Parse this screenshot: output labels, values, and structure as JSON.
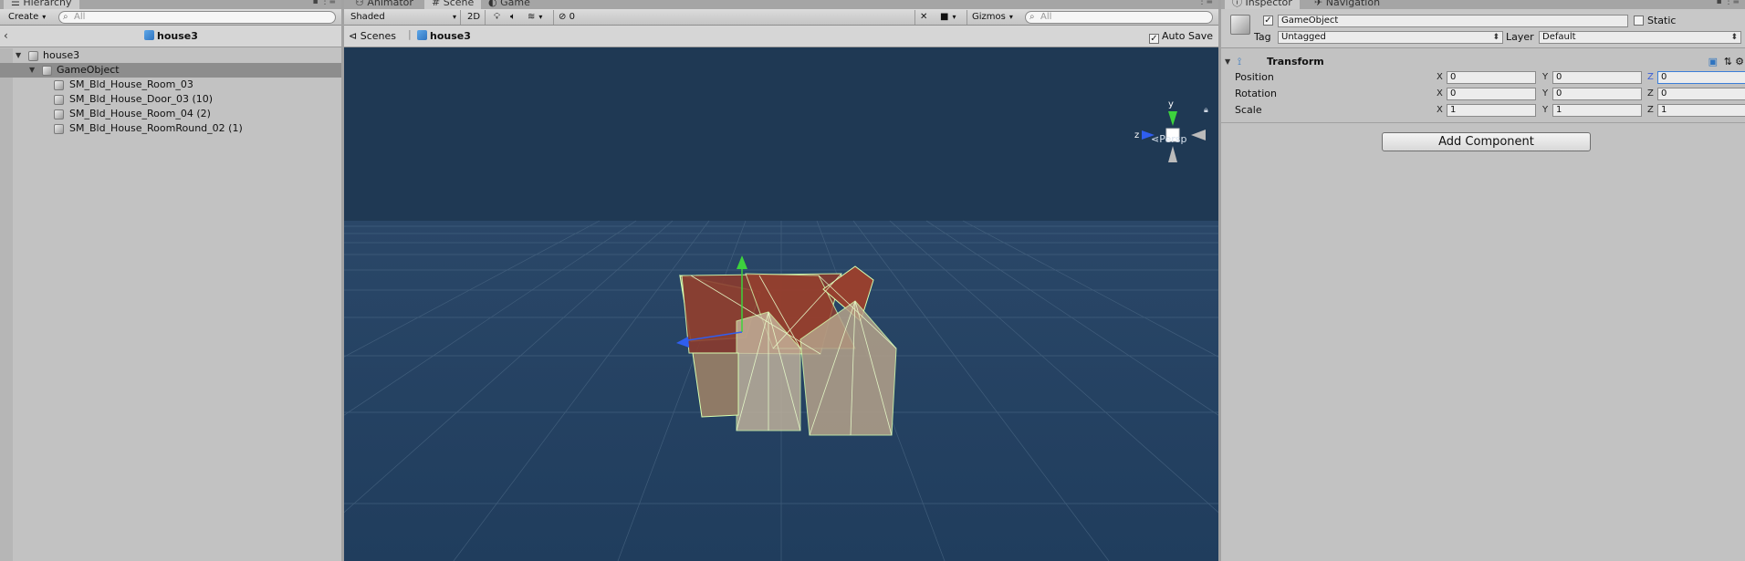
{
  "hierarchy": {
    "tab": "Hierarchy",
    "create": "Create",
    "search_placeholder": "All",
    "scene_name": "house3",
    "items": [
      {
        "label": "house3"
      },
      {
        "label": "GameObject"
      },
      {
        "label": "SM_Bld_House_Room_03"
      },
      {
        "label": "SM_Bld_House_Door_03 (10)"
      },
      {
        "label": "SM_Bld_House_Room_04 (2)"
      },
      {
        "label": "SM_Bld_House_RoomRound_02 (1)"
      }
    ]
  },
  "scene": {
    "tabs": [
      "Animator",
      "Scene",
      "Game"
    ],
    "shading": "Shaded",
    "mode_2d": "2D",
    "fx_count": "0",
    "gizmos": "Gizmos",
    "search_placeholder": "All",
    "breadcrumb_root": "Scenes",
    "breadcrumb_current": "house3",
    "auto_save": "Auto Save",
    "persp_label": "Persp",
    "gizmo_axes": {
      "y": "y",
      "z": "z"
    }
  },
  "inspector": {
    "tabs": [
      "Inspector",
      "Navigation"
    ],
    "object_name": "GameObject",
    "static_label": "Static",
    "tag_label": "Tag",
    "tag_value": "Untagged",
    "layer_label": "Layer",
    "layer_value": "Default",
    "component": "Transform",
    "transform": {
      "position": {
        "label": "Position",
        "x": "0",
        "y": "0",
        "z": "0"
      },
      "rotation": {
        "label": "Rotation",
        "x": "0",
        "y": "0",
        "z": "0"
      },
      "scale": {
        "label": "Scale",
        "x": "1",
        "y": "1",
        "z": "1"
      }
    },
    "add_component": "Add Component"
  },
  "colors": {
    "scene_bg": "#1f3a55",
    "grid": "#4d6a88",
    "selection_outline": "#d8ffb0",
    "roof": "#8a3b2e",
    "accent_blue": "#3b7ed8"
  }
}
